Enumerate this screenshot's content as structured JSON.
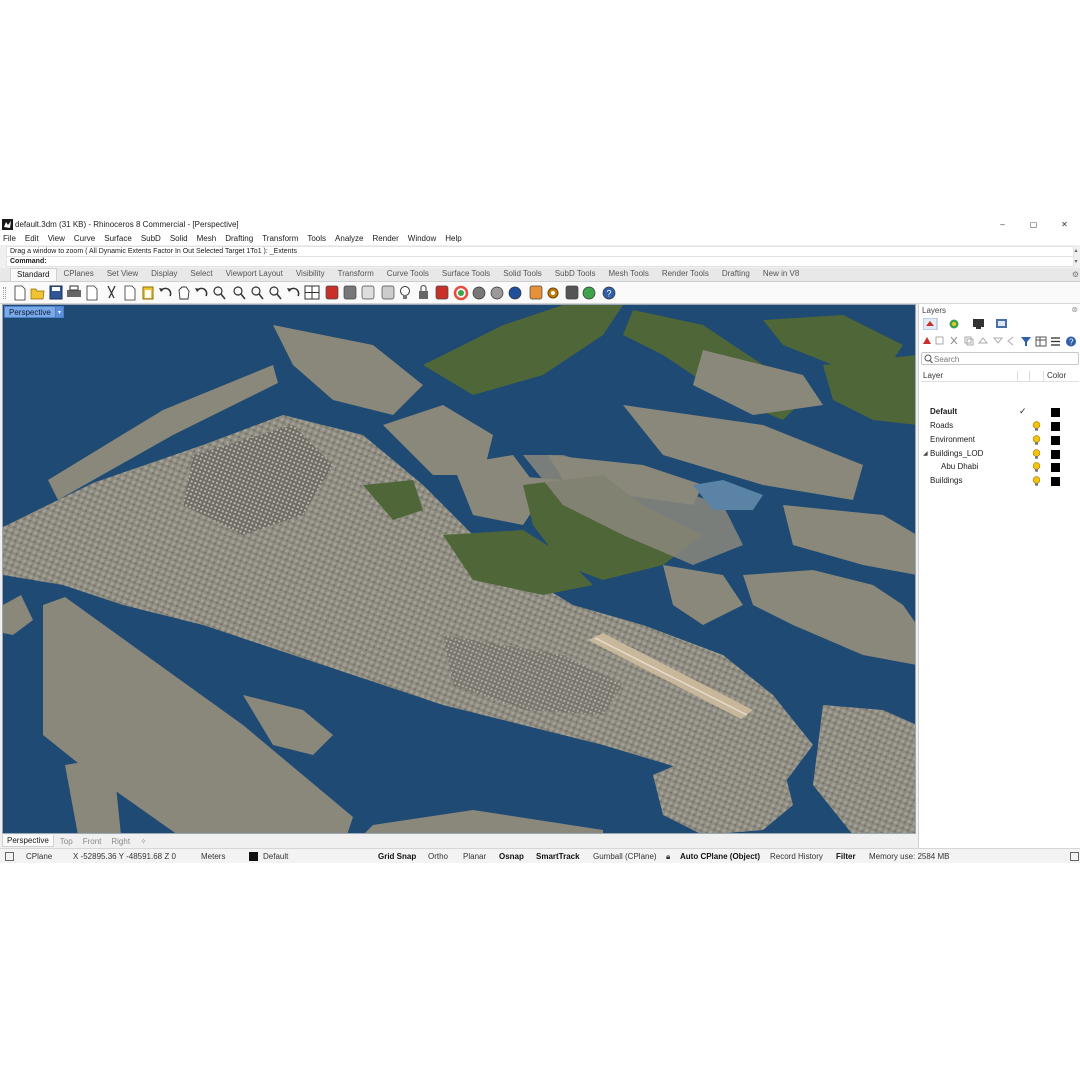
{
  "window": {
    "title": "default.3dm (31 KB) - Rhinoceros 8 Commercial - [Perspective]",
    "minimize": "–",
    "maximize": "▢",
    "close": "✕"
  },
  "menu": [
    "File",
    "Edit",
    "View",
    "Curve",
    "Surface",
    "SubD",
    "Solid",
    "Mesh",
    "Drafting",
    "Transform",
    "Tools",
    "Analyze",
    "Render",
    "Window",
    "Help"
  ],
  "command": {
    "history": "Drag a window to zoom ( All  Dynamic  Extents  Factor  In  Out  Selected  Target  1To1 ): _Extents",
    "prompt": "Command:"
  },
  "toolbar_tabs": {
    "active": "Standard",
    "items": [
      "Standard",
      "CPlanes",
      "Set View",
      "Display",
      "Select",
      "Viewport Layout",
      "Visibility",
      "Transform",
      "Curve Tools",
      "Surface Tools",
      "Solid Tools",
      "SubD Tools",
      "Mesh Tools",
      "Render Tools",
      "Drafting",
      "New in V8"
    ]
  },
  "toolbar_icons": [
    "new-icon",
    "open-icon",
    "save-icon",
    "print-icon",
    "import-icon",
    "cut-icon",
    "copy-icon",
    "paste-icon",
    "undo-icon",
    "pan-icon",
    "rotate-view-icon",
    "zoom-window-icon",
    "zoom-dynamic-icon",
    "zoom-extents-icon",
    "zoom-selected-icon",
    "rotate-icon",
    "four-viewports-icon",
    "car-render-icon",
    "shaded-icon",
    "hide-icon",
    "points-on-icon",
    "light-icon",
    "lock-icon",
    "material-icon",
    "color-wheel-icon",
    "sphere-wire-icon",
    "sphere-mesh-icon",
    "globe-icon",
    "pencil-icon",
    "gear-icon",
    "dimension-icon",
    "render-globe-icon",
    "help-icon"
  ],
  "viewport": {
    "label": "Perspective",
    "caret": "▾",
    "tabs": [
      "Perspective",
      "Top",
      "Front",
      "Right"
    ],
    "active_tab": "Perspective",
    "add": "✧"
  },
  "status": {
    "cplane": "CPlane",
    "coords": "X -52895.36 Y -48591.68 Z 0",
    "units": "Meters",
    "layer": "Default",
    "layer_color": "#000000",
    "grid_snap": "Grid Snap",
    "ortho": "Ortho",
    "planar": "Planar",
    "osnap": "Osnap",
    "smarttrack": "SmartTrack",
    "gumball": "Gumball (CPlane)",
    "auto_cplane": "Auto CPlane (Object)",
    "record_history": "Record History",
    "filter": "Filter",
    "memory": "Memory use: 2584 MB"
  },
  "layers": {
    "title": "Layers",
    "search_placeholder": "Search",
    "col_layer": "Layer",
    "col_color": "Color",
    "items": [
      {
        "name": "Default",
        "current": true,
        "color": "#000000"
      },
      {
        "name": "Roads",
        "current": false,
        "color": "#000000"
      },
      {
        "name": "Environment",
        "current": false,
        "color": "#000000"
      },
      {
        "name": "Buildings_LOD",
        "current": false,
        "expanded": true,
        "color": "#000000"
      },
      {
        "name": "Abu Dhabi",
        "current": false,
        "child": true,
        "color": "#000000"
      },
      {
        "name": "Buildings",
        "current": false,
        "color": "#000000"
      }
    ]
  },
  "colors": {
    "water": "#1e4a73",
    "land": "#8a877b",
    "vegetation": "#4f6638",
    "viewport_label": "#7aaae8"
  }
}
